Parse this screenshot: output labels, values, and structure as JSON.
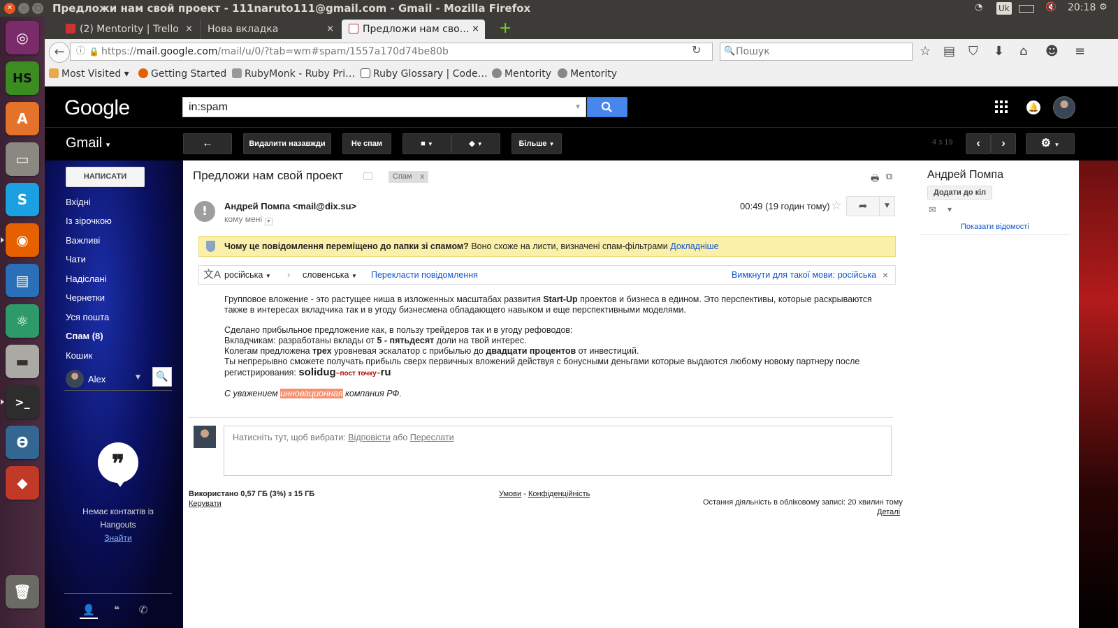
{
  "os": {
    "window_title": "Предложи нам свой проект - 111naruto111@gmail.com - Gmail - Mozilla Firefox",
    "keyboard_layout": "Uk",
    "clock": "20:18"
  },
  "launcher": {
    "apps": [
      "ubuntu-dash",
      "hexchat",
      "software-center",
      "files",
      "skype",
      "firefox",
      "libreoffice-writer",
      "atom",
      "disks",
      "terminal",
      "pgadmin",
      "git-gui",
      "trash"
    ],
    "colors": {
      "background": "#4a2a3f"
    }
  },
  "browser": {
    "tabs": [
      {
        "label": "(2) Mentority | Trello",
        "close": "×"
      },
      {
        "label": "Нова вкладка",
        "close": "×"
      },
      {
        "label": "Предложи нам сво…",
        "close": "×"
      }
    ],
    "new_tab": "+",
    "url": {
      "scheme": "https://",
      "host": "mail.google.com",
      "path": "/mail/u/0/?tab=wm#spam/1557a170d74be80b"
    },
    "search_placeholder": "Пошук",
    "bookmarks": [
      "Most Visited",
      "Getting Started",
      "RubyMonk - Ruby Pri…",
      "Ruby Glossary | Code…",
      "Mentority",
      "Mentority"
    ]
  },
  "gmail": {
    "logo": "Google",
    "search_value": "in:spam",
    "product": "Gmail",
    "toolbar": {
      "back": "←",
      "delete_forever": "Видалити назавжди",
      "not_spam": "Не спам",
      "more": "Більше",
      "count": "4 з 19"
    },
    "compose": "НАПИСАТИ",
    "nav": [
      {
        "label": "Вхідні"
      },
      {
        "label": "Із зірочкою"
      },
      {
        "label": "Важливі"
      },
      {
        "label": "Чати"
      },
      {
        "label": "Надіслані"
      },
      {
        "label": "Чернетки"
      },
      {
        "label": "Уся пошта"
      },
      {
        "label": "Спам (8)"
      },
      {
        "label": "Кошик"
      }
    ],
    "hangouts": {
      "user": "Alex",
      "empty_text": "Немає контактів із Hangouts",
      "find_link": "Знайти"
    },
    "message": {
      "subject": "Предложи нам свой проект",
      "label_chip": "Спам",
      "label_chip_close": "x",
      "sender": "Андрей Помпа <mail@dix.su>",
      "to": "кому мені",
      "time": "00:49 (19 годин тому)",
      "spam_banner": {
        "question": "Чому це повідомлення переміщено до папки зі спамом?",
        "explanation": "Воно схоже на листи, визначені спам-фільтрами",
        "learn_more": "Докладніше"
      },
      "translate": {
        "from": "російська",
        "to": "словенська",
        "action": "Перекласти повідомлення",
        "disable": "Вимкнути для такої мови: російська",
        "close": "×"
      },
      "body": {
        "p1_a": "Групповое вложение - это растущее ниша в изложенных масштабах развития ",
        "p1_b": "Start-Up",
        "p1_c": " проектов и бизнеса в едином. Это перспективы, которые раскрываются также в интересах вкладчика так и в угоду бизнесмена обладающего навыком и еще перспективными моделями.",
        "p2_l1": "Сделано прибыльное предложение как, в пользу трейдеров так и в угоду рефоводов:",
        "p2_l2_a": "Вкладчикам: разработаны вклады от ",
        "p2_l2_b": "5 - пятьдесят",
        "p2_l2_c": " доли на твой интерес.",
        "p2_l3_a": "Колегам предложена ",
        "p2_l3_b": "трех",
        "p2_l3_c": " уровневая эскалатор с прибылью до ",
        "p2_l3_d": "двадцати процентов",
        "p2_l3_e": " от инвестиций.",
        "p2_l4": "Ты непрерывно сможете получать прибыль сверх первичных вложений действуя с бонусными деньгами которые выдаются любому новому партнеру после регистрирования: ",
        "link_a": "solidug",
        "link_b": "~пост точку~",
        "link_c": "ru",
        "sig_a": "С уважением ",
        "sig_b": "инновационная",
        "sig_c": " компания РФ."
      },
      "reply_box": {
        "prompt": "Натисніть тут, щоб вибрати: ",
        "reply": "Відповісти",
        "or": " або ",
        "forward": "Переслати"
      }
    },
    "footer": {
      "storage": "Використано 0,57 ГБ (3%) з 15 ГБ",
      "manage": "Керувати",
      "terms": "Умови",
      "separator": " - ",
      "privacy": "Конфіденційність",
      "last_activity": "Остання діяльність в обліковому записі: 20 хвилин тому",
      "details": "Деталі"
    },
    "contact": {
      "name": "Андрей Помпа",
      "add_to_circles": "Додати до кіл",
      "show_details": "Показати відомості"
    },
    "colors": {
      "search_button": "#4787ed",
      "spam_banner": "#fbf0a9",
      "link": "#1155cc",
      "highlight": "#f58f6f"
    }
  }
}
